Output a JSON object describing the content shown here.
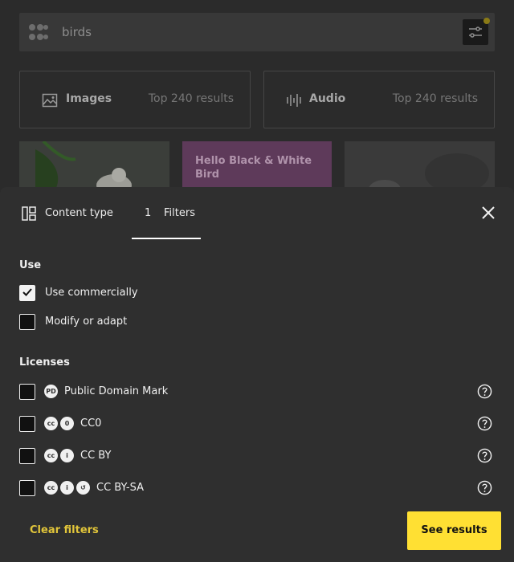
{
  "search": {
    "query": "birds",
    "placeholder": ""
  },
  "media": {
    "images": {
      "title": "Images",
      "count": "Top 240 results"
    },
    "audio": {
      "title": "Audio",
      "count": "Top 240 results"
    }
  },
  "thumbnails": [
    {
      "title": ""
    },
    {
      "title": "Hello Black & White Bird"
    },
    {
      "title": ""
    }
  ],
  "sheet": {
    "tabs": {
      "content_type": "Content type",
      "filters_count": "1",
      "filters": "Filters"
    },
    "use": {
      "title": "Use",
      "options": [
        {
          "label": "Use commercially",
          "checked": true
        },
        {
          "label": "Modify or adapt",
          "checked": false
        }
      ]
    },
    "licenses": {
      "title": "Licenses",
      "options": [
        {
          "label": "Public Domain Mark",
          "icons": [
            "pdm-icon"
          ]
        },
        {
          "label": "CC0",
          "icons": [
            "cc-icon",
            "zero-icon"
          ]
        },
        {
          "label": "CC BY",
          "icons": [
            "cc-icon",
            "by-icon"
          ]
        },
        {
          "label": "CC BY-SA",
          "icons": [
            "cc-icon",
            "by-icon",
            "sa-icon"
          ]
        }
      ]
    },
    "clear_label": "Clear filters",
    "see_results_label": "See results"
  },
  "colors": {
    "accent": "#ffe033",
    "accent_text": "#e1c53a",
    "sheet_bg": "#2f2f2f"
  }
}
